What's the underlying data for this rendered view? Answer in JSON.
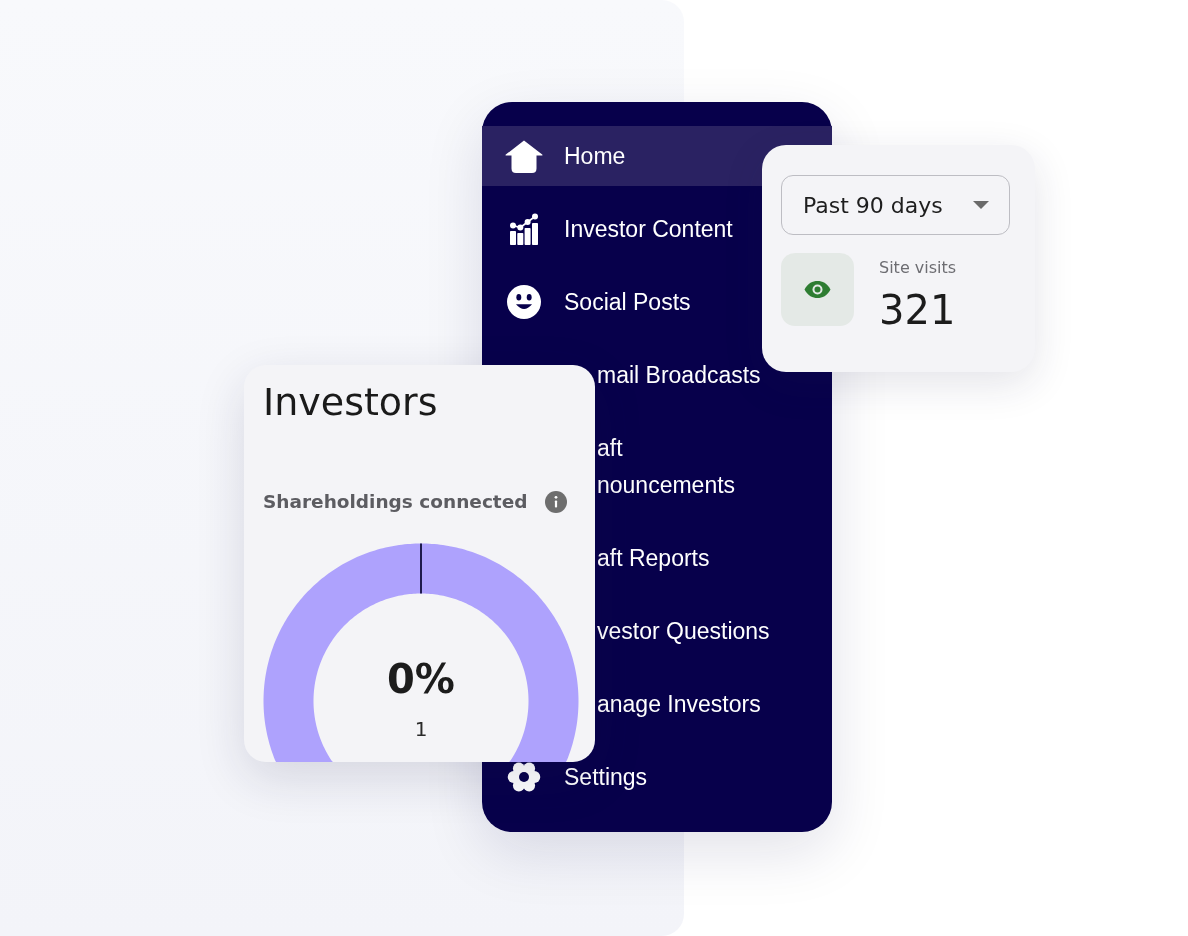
{
  "sidebar": {
    "items": [
      {
        "label": "Home",
        "kind": "full",
        "selected": true
      },
      {
        "label": "Investor Content",
        "kind": "full",
        "selected": false
      },
      {
        "label": "Social Posts",
        "kind": "full",
        "selected": false
      },
      {
        "label": "mail Broadcasts",
        "kind": "covered",
        "selected": false
      },
      {
        "label": "aft\nnouncements",
        "kind": "covered",
        "selected": false
      },
      {
        "label": "aft Reports",
        "kind": "covered",
        "selected": false
      },
      {
        "label": "vestor Questions",
        "kind": "covered",
        "selected": false
      },
      {
        "label": "anage Investors",
        "kind": "covered",
        "selected": false
      },
      {
        "label": "Settings",
        "kind": "full",
        "selected": false
      }
    ]
  },
  "site_visits_card": {
    "period_dropdown": {
      "value": "Past 90 days"
    },
    "metric": {
      "label": "Site visits",
      "value": "321"
    }
  },
  "investors_card": {
    "title": "Investors",
    "subtitle": "Shareholdings connected",
    "donut": {
      "value": "0%",
      "count": "1"
    }
  }
}
